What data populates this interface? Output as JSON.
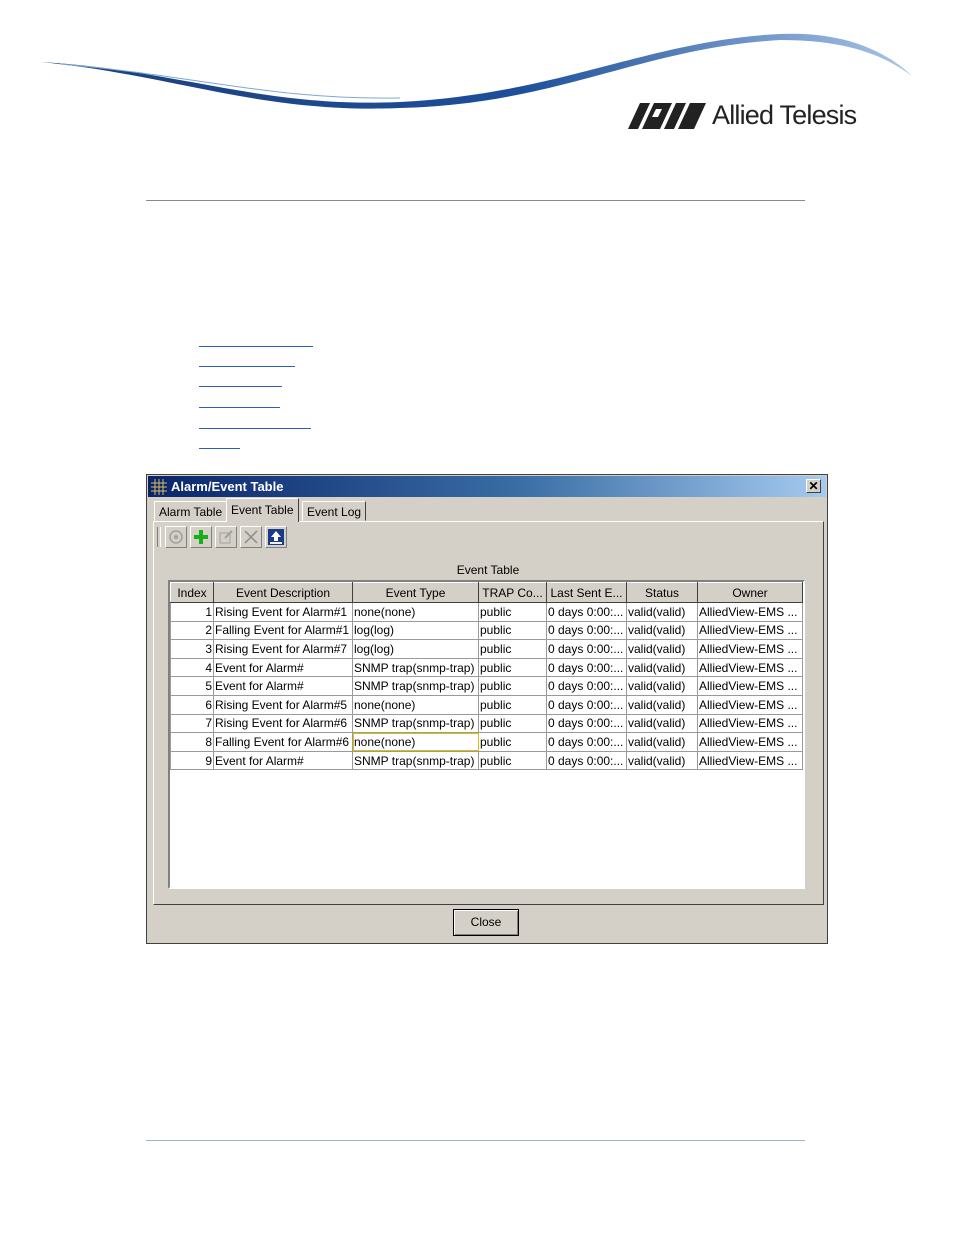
{
  "brand": {
    "name": "Allied Telesis"
  },
  "dialog": {
    "title": "Alarm/Event Table",
    "close_glyph": "✕",
    "tabs": [
      {
        "label": "Alarm Table",
        "active": false
      },
      {
        "label": "Event Table",
        "active": true
      },
      {
        "label": "Event Log",
        "active": false
      }
    ],
    "toolbar": {
      "buttons": [
        {
          "icon": "settings-icon",
          "enabled": false
        },
        {
          "icon": "add-icon",
          "enabled": true
        },
        {
          "icon": "edit-icon",
          "enabled": false
        },
        {
          "icon": "delete-icon",
          "enabled": false
        },
        {
          "icon": "refresh-upload-icon",
          "enabled": true
        }
      ]
    },
    "table_title": "Event Table",
    "columns": [
      "Index",
      "Event Description",
      "Event Type",
      "TRAP Co...",
      "Last Sent E...",
      "Status",
      "Owner"
    ],
    "rows": [
      [
        "1",
        "Rising Event for Alarm#1",
        "none(none)",
        "public",
        "0 days 0:00:...",
        "valid(valid)",
        "AlliedView-EMS ..."
      ],
      [
        "2",
        "Falling Event for Alarm#1",
        "log(log)",
        "public",
        "0 days 0:00:...",
        "valid(valid)",
        "AlliedView-EMS ..."
      ],
      [
        "3",
        "Rising Event for Alarm#7",
        "log(log)",
        "public",
        "0 days 0:00:...",
        "valid(valid)",
        "AlliedView-EMS ..."
      ],
      [
        "4",
        "Event for Alarm#",
        "SNMP trap(snmp-trap)",
        "public",
        "0 days 0:00:...",
        "valid(valid)",
        "AlliedView-EMS ..."
      ],
      [
        "5",
        "Event for Alarm#",
        "SNMP trap(snmp-trap)",
        "public",
        "0 days 0:00:...",
        "valid(valid)",
        "AlliedView-EMS ..."
      ],
      [
        "6",
        "Rising Event for Alarm#5",
        "none(none)",
        "public",
        "0 days 0:00:...",
        "valid(valid)",
        "AlliedView-EMS ..."
      ],
      [
        "7",
        "Rising Event for Alarm#6",
        "SNMP trap(snmp-trap)",
        "public",
        "0 days 0:00:...",
        "valid(valid)",
        "AlliedView-EMS ..."
      ],
      [
        "8",
        "Falling Event for Alarm#6",
        "none(none)",
        "public",
        "0 days 0:00:...",
        "valid(valid)",
        "AlliedView-EMS ..."
      ],
      [
        "9",
        "Event for Alarm#",
        "SNMP trap(snmp-trap)",
        "public",
        "0 days 0:00:...",
        "valid(valid)",
        "AlliedView-EMS ..."
      ]
    ],
    "close_button": "Close"
  },
  "colors": {
    "dialog_bg": "#d4d0c8",
    "titlebar_start": "#0a246a",
    "link": "#2a5fbf",
    "focus_cell": "#e0c000"
  }
}
